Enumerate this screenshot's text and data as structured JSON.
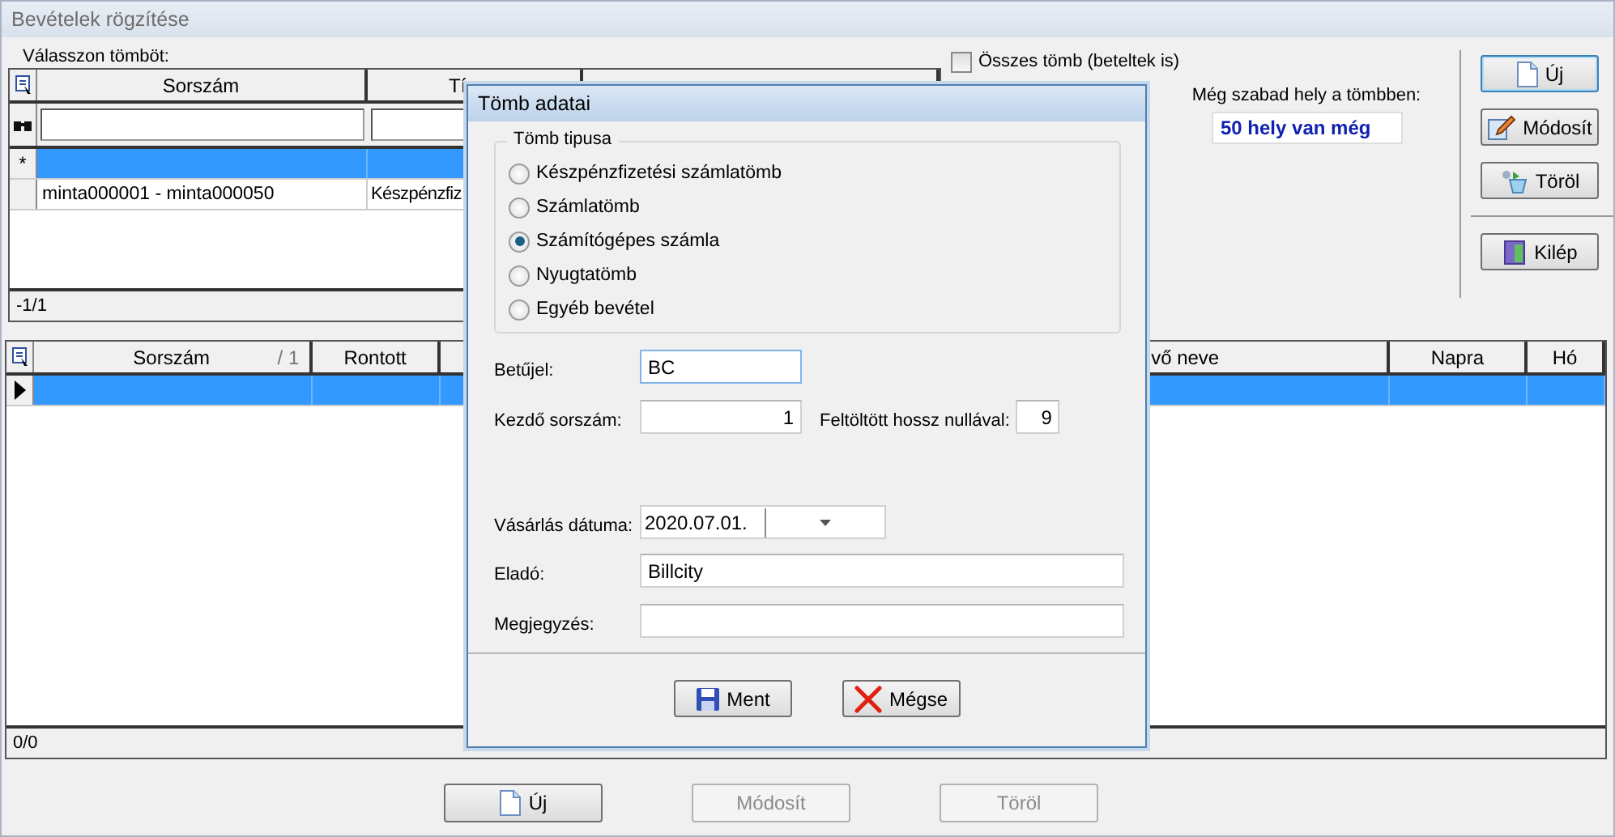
{
  "window": {
    "title": "Bevételek rögzítése"
  },
  "block_grid": {
    "label": "Válasszon tömböt:",
    "columns": [
      {
        "label": "Sorszám"
      },
      {
        "label": "Tí"
      },
      {}
    ],
    "rows": [
      {
        "kind": "new",
        "marker": "*",
        "selected": true,
        "cells": []
      },
      {
        "kind": "data",
        "selected": false,
        "cells": [
          "minta000001 - minta000050",
          "Készpénzfiz"
        ]
      }
    ],
    "position": "-1/1"
  },
  "all_blocks": {
    "label": "Összes tömb (beteltek is)",
    "checked": false
  },
  "free_space": {
    "label": "Még szabad hely a tömbben:",
    "value": "50 hely van még"
  },
  "side_buttons": [
    {
      "label": "Új",
      "kind": "new",
      "focused": true
    },
    {
      "label": "Módosít",
      "kind": "edit",
      "focused": false
    },
    {
      "label": "Töröl",
      "kind": "delete",
      "focused": false
    },
    {
      "label": "Kilép",
      "kind": "exit",
      "focused": false
    }
  ],
  "entries_grid": {
    "columns": [
      {
        "label": "Sorszám",
        "sort": "/ 1"
      },
      {
        "label": "Rontott"
      },
      {},
      {
        "label": "vő neve"
      },
      {
        "label": "Napra"
      },
      {
        "label": "Hó"
      }
    ],
    "rows": [
      {
        "selected": true
      }
    ],
    "position": "0/0"
  },
  "footer_buttons": [
    {
      "label": "Új",
      "kind": "new",
      "disabled": false
    },
    {
      "label": "Módosít",
      "kind": "edit",
      "disabled": true
    },
    {
      "label": "Töröl",
      "kind": "delete",
      "disabled": true
    }
  ],
  "dialog": {
    "title": "Tömb adatai",
    "group": {
      "label": "Tömb tipusa",
      "options": [
        {
          "label": "Készpénzfizetési számlatömb",
          "selected": false
        },
        {
          "label": "Számlatömb",
          "selected": false
        },
        {
          "label": "Számítógépes számla",
          "selected": true
        },
        {
          "label": "Nyugtatömb",
          "selected": false
        },
        {
          "label": "Egyéb bevétel",
          "selected": false
        }
      ]
    },
    "letter": {
      "label": "Betűjel:",
      "value": "BC"
    },
    "start": {
      "label": "Kezdő sorszám:",
      "value": "1"
    },
    "padding": {
      "label": "Feltöltött hossz nullával:",
      "value": "9"
    },
    "date": {
      "label": "Vásárlás dátuma:",
      "value": "2020.07.01."
    },
    "seller": {
      "label": "Eladó:",
      "value": "Billcity"
    },
    "note": {
      "label": "Megjegyzés:"
    },
    "buttons": [
      {
        "label": "Ment",
        "kind": "save"
      },
      {
        "label": "Mégse",
        "kind": "cancel"
      }
    ]
  }
}
